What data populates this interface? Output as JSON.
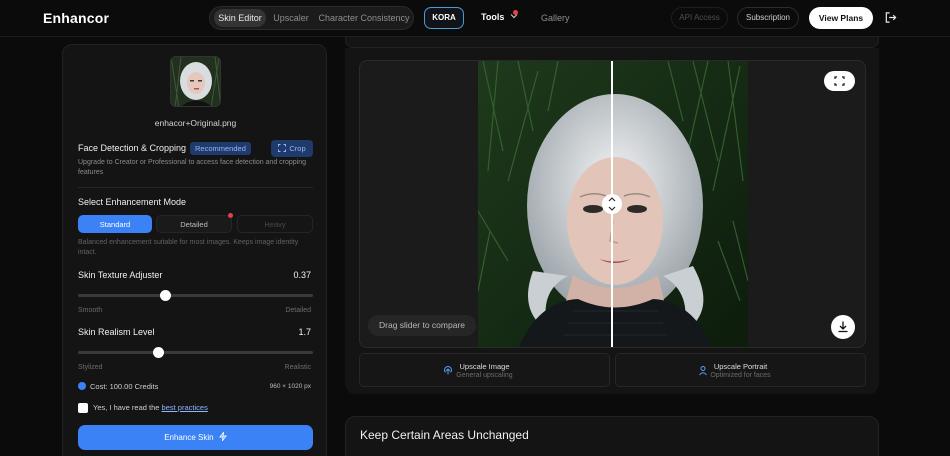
{
  "app": {
    "brand": "Enhancor"
  },
  "nav": {
    "tabs": [
      {
        "label": "Skin Editor",
        "active": true
      },
      {
        "label": "Upscaler",
        "active": false
      },
      {
        "label": "Character Consistency",
        "active": false
      }
    ],
    "kora": "KORA",
    "tools": "Tools",
    "gallery": "Gallery",
    "api_access": "API Access",
    "subscription": "Subscription",
    "view_plans": "View Plans",
    "icons": {
      "logout": "logout-icon",
      "tools_chevron": "chevron-down-icon"
    }
  },
  "editor": {
    "filename": "enhacor+Original.png",
    "face_detection": {
      "title": "Face Detection & Cropping",
      "badge": "Recommended",
      "crop_label": "Crop",
      "description": "Upgrade to Creator or Professional to access face detection and cropping features"
    },
    "enhancement_mode": {
      "title": "Select Enhancement Mode",
      "modes": [
        {
          "label": "Standard",
          "state": "active"
        },
        {
          "label": "Detailed",
          "state": "available"
        },
        {
          "label": "Heavy",
          "state": "disabled"
        }
      ],
      "description": "Balanced enhancement suitable for most images. Keeps image identity intact."
    },
    "skin_texture": {
      "label": "Skin Texture Adjuster",
      "value": "0.37",
      "fraction": 0.37,
      "min_label": "Smooth",
      "max_label": "Detailed"
    },
    "skin_realism": {
      "label": "Skin Realism Level",
      "value": "1.7",
      "fraction": 0.34,
      "min_label": "Stylized",
      "max_label": "Realistic"
    },
    "cost": "Cost: 100.00 Credits",
    "dimensions": "960 × 1020 px",
    "agree_prefix": "Yes, I have read the",
    "agree_link": "best practices",
    "enhance_button": "Enhance Skin"
  },
  "preview": {
    "drag_hint": "Drag slider to compare",
    "actions": [
      {
        "title": "Upscale Image",
        "subtitle": "General upscaling",
        "icon": "upscale-icon"
      },
      {
        "title": "Upscale Portrait",
        "subtitle": "Optimized for faces",
        "icon": "portrait-icon"
      }
    ],
    "icons": {
      "fullscreen": "expand-icon",
      "download": "download-icon",
      "compare_handle": "compare-handle-icon"
    }
  },
  "keep_areas": {
    "title": "Keep Certain Areas Unchanged"
  },
  "colors": {
    "accent": "#3b82f6",
    "background": "#0b0b0b",
    "panel": "#141414",
    "badge_bg": "#1f3a6b"
  }
}
